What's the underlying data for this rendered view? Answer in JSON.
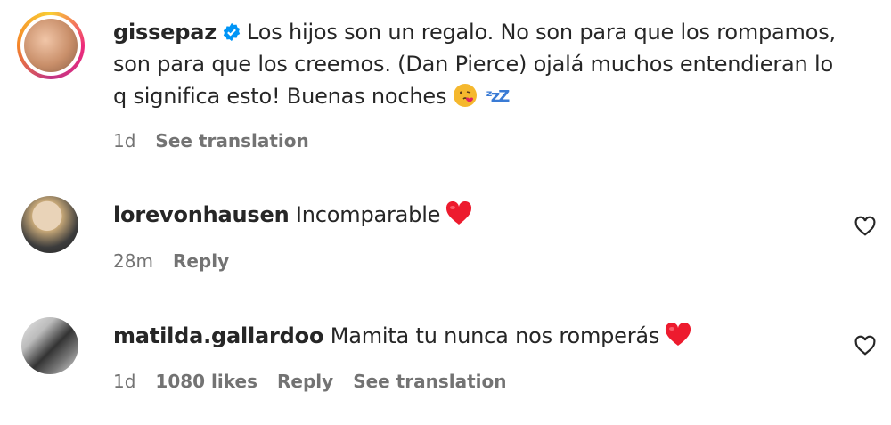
{
  "comments": [
    {
      "username": "gissepaz",
      "verified": true,
      "text": "Los hijos son un regalo. No son para que los rompamos, son para que los creemos. (Dan Pierce) ojalá muchos entendieran lo q significa esto! Buenas noches",
      "emojis": [
        "kissing-face-emoji",
        "zzz-emoji"
      ],
      "time": "1d",
      "actions": [
        "See translation"
      ]
    },
    {
      "username": "lorevonhausen",
      "text": "Incomparable",
      "emojis": [
        "red-heart-emoji"
      ],
      "time": "28m",
      "actions": [
        "Reply"
      ]
    },
    {
      "username": "matilda.gallardoo",
      "text": "Mamita tu nunca nos romperás",
      "emojis": [
        "red-heart-emoji"
      ],
      "time": "1d",
      "likes": "1080 likes",
      "actions": [
        "Reply",
        "See translation"
      ]
    }
  ],
  "colors": {
    "text": "#262626",
    "muted": "#737373",
    "verified_blue": "#0095f6",
    "heart_red": "#ed1b2e"
  }
}
